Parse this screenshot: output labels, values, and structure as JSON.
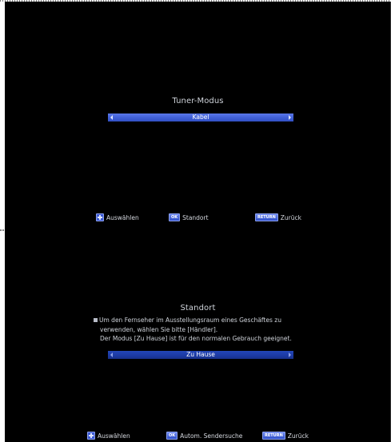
{
  "tuner_panel": {
    "title": "Tuner-Modus",
    "selected_value": "Kabel"
  },
  "help_bar_1": {
    "select_label": "Auswählen",
    "ok_key": "OK",
    "ok_label": "Standort",
    "return_key": "RETURN",
    "return_label": "Zurück"
  },
  "location_panel": {
    "title": "Standort",
    "description_lines": [
      "Um den Fernseher im Ausstellungsraum eines Geschäftes zu",
      "verwenden, wählen Sie bitte [Händler].",
      "Der Modus [Zu Hause] ist für den normalen Gebrauch geeignet."
    ],
    "selected_value": "Zu Hause"
  },
  "help_bar_2": {
    "select_label": "Auswählen",
    "ok_key": "OK",
    "ok_label": "Autom. Sendersuche",
    "return_key": "RETURN",
    "return_label": "Zurück"
  },
  "colors": {
    "background": "#000000",
    "selector_active": "#4666dd",
    "selector_inactive": "#1c3aa3",
    "text": "#cfd3da"
  }
}
